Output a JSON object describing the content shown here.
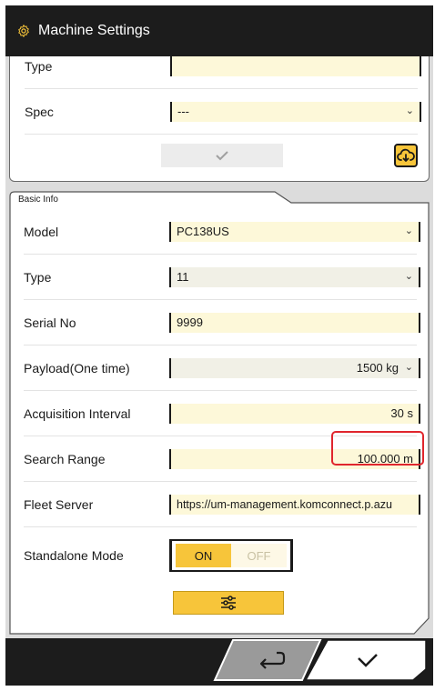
{
  "title": {
    "text": "Machine Settings",
    "icon": "gear-icon",
    "icon_color": "#f7c53a"
  },
  "top_panel": {
    "partial_row": {
      "label": "Type"
    },
    "spec": {
      "label": "Spec",
      "value": "---"
    },
    "confirm_icon": "check-icon",
    "download_icon": "cloud-download-icon"
  },
  "basic_info": {
    "tab_label": "Basic Info",
    "rows": [
      {
        "label": "Model",
        "value": "PC138US",
        "kind": "select"
      },
      {
        "label": "Type",
        "value": "11",
        "kind": "select"
      },
      {
        "label": "Serial No",
        "value": "9999",
        "kind": "text"
      },
      {
        "label": "Payload(One time)",
        "value": "1500 kg",
        "kind": "select"
      },
      {
        "label": "Acquisition Interval",
        "value": "30 s",
        "kind": "text"
      },
      {
        "label": "Search Range",
        "value": "100.000 m",
        "kind": "text"
      },
      {
        "label": "Fleet Server",
        "value": "https://um-management.komconnect.p.azu",
        "kind": "text"
      }
    ],
    "standalone": {
      "label": "Standalone Mode",
      "on": "ON",
      "off": "OFF",
      "selected": "ON"
    },
    "adjust_icon": "sliders-icon"
  },
  "footer": {
    "back_icon": "return-arrow-icon",
    "confirm_icon": "check-icon"
  },
  "colors": {
    "accent": "#f7c53a",
    "highlight": "#e0262d",
    "field_bg": "#fdf8d9"
  }
}
